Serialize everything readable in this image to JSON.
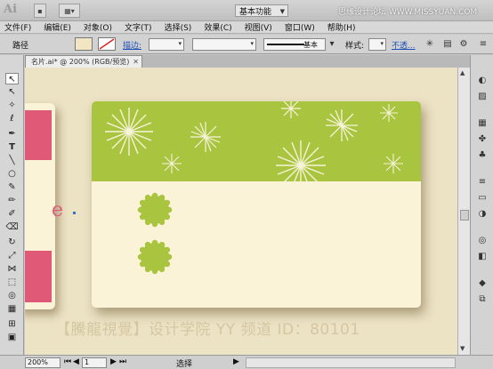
{
  "app": {
    "logo": "Ai",
    "workspace": "基本功能",
    "watermark_top": "思缘设计论坛 WWW.MISSYUAN.COM"
  },
  "menu": [
    "文件(F)",
    "编辑(E)",
    "对象(O)",
    "文字(T)",
    "选择(S)",
    "效果(C)",
    "视图(V)",
    "窗口(W)",
    "帮助(H)"
  ],
  "control": {
    "selection_label": "路径",
    "stroke_link": "描边:",
    "profile": "基本",
    "style_label": "样式:",
    "opacity_link": "不透..."
  },
  "document": {
    "tab_title": "名片.ai* @ 200% (RGB/预览)"
  },
  "canvas": {
    "watermark": "【騰龍視覺】设计学院  YY 频道 ID：80101",
    "left_card_letter": "e",
    "colors": {
      "pink": "#e05a77",
      "green": "#a9c43e",
      "cream": "#fbf3d8",
      "pasteboard": "#ece2c4"
    }
  },
  "status": {
    "zoom": "200%",
    "page": "1",
    "tool": "选择"
  }
}
